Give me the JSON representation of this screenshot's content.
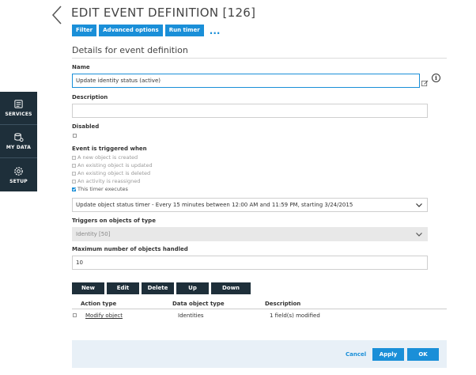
{
  "header": {
    "title": "EDIT EVENT DEFINITION [126]"
  },
  "toolbar": {
    "buttons": [
      "Filter",
      "Advanced options",
      "Run timer"
    ],
    "more": "..."
  },
  "section": {
    "title": "Details for event definition"
  },
  "sidebar": {
    "items": [
      {
        "label": "SERVICES",
        "icon": "services-icon"
      },
      {
        "label": "MY DATA",
        "icon": "my-data-icon"
      },
      {
        "label": "SETUP",
        "icon": "setup-icon"
      }
    ]
  },
  "form": {
    "name": {
      "label": "Name",
      "value": "Update identity status (active)"
    },
    "description": {
      "label": "Description",
      "value": ""
    },
    "disabled": {
      "label": "Disabled",
      "checked": false
    },
    "trigger": {
      "label": "Event is triggered when",
      "options": [
        {
          "label": "A new object is created",
          "checked": false
        },
        {
          "label": "An existing object is updated",
          "checked": false
        },
        {
          "label": "An existing object is deleted",
          "checked": false
        },
        {
          "label": "An activity is reassigned",
          "checked": false
        },
        {
          "label": "This timer executes",
          "checked": true
        }
      ]
    },
    "timer": {
      "value": "Update object status timer - Every 15 minutes between 12:00 AM and 11:59 PM, starting 3/24/2015"
    },
    "object_type": {
      "label": "Triggers on objects of type",
      "value": "Identity [50]"
    },
    "max_objects": {
      "label": "Maximum number of objects handled",
      "value": "10"
    }
  },
  "actions": {
    "buttons": [
      "New",
      "Edit",
      "Delete",
      "Up",
      "Down"
    ],
    "columns": [
      "Action type",
      "Data object type",
      "Description"
    ],
    "rows": [
      {
        "action_type": "Modify object",
        "data_object_type": "Identities",
        "description": "1 field(s) modified",
        "checked": false
      }
    ]
  },
  "footer": {
    "cancel": "Cancel",
    "apply": "Apply",
    "ok": "OK"
  },
  "colors": {
    "accent": "#1a8fd8",
    "sidebar": "#1e2f3a",
    "footer_bg": "#e8f0f7"
  }
}
